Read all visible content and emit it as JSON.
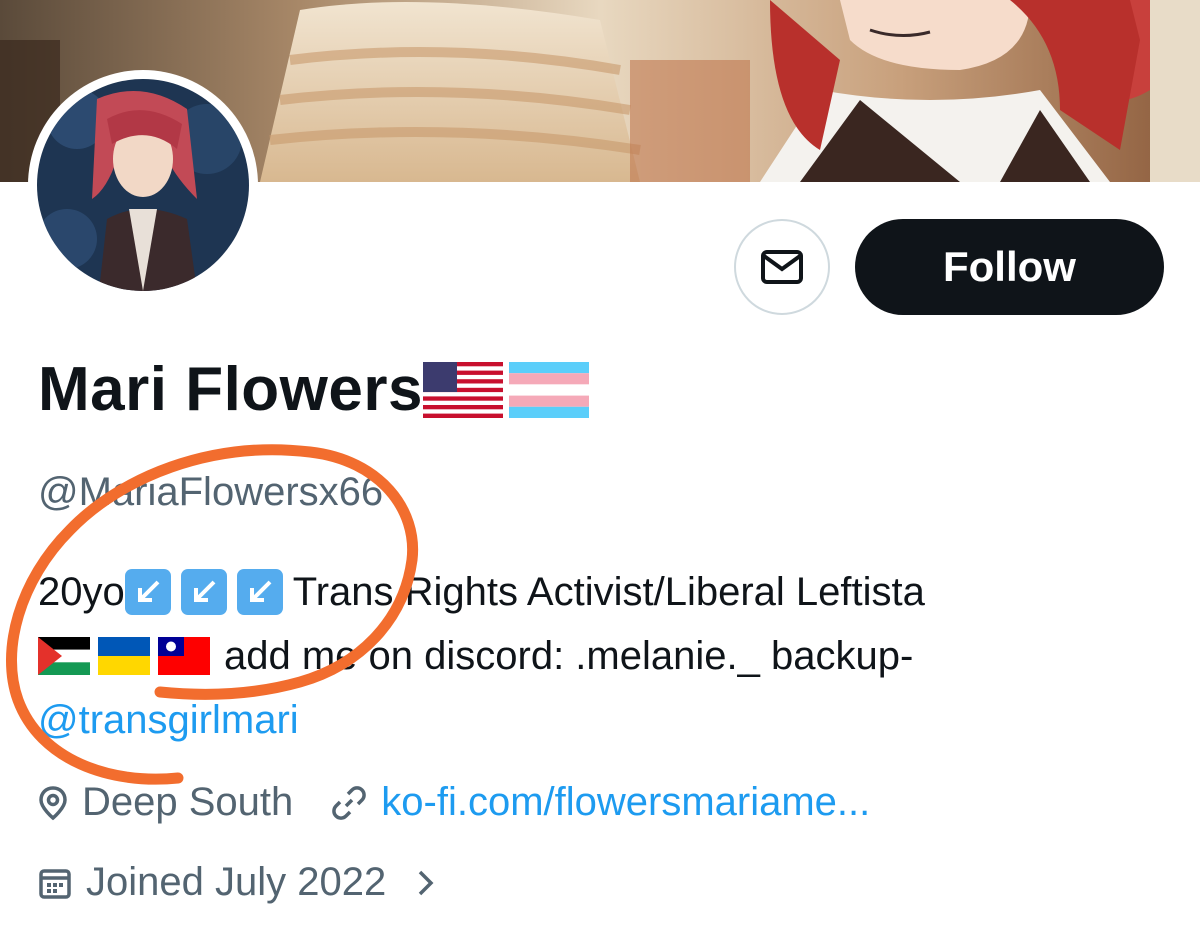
{
  "profile": {
    "display_name": "Mari Flowers",
    "handle": "@MariaFlowersx66",
    "bio_line1_prefix": "20yo",
    "bio_line1_text": "Trans Rights Activist/Liberal Leftista",
    "bio_line2_text": "add me on discord: .melanie._ backup-",
    "bio_mention": "@transgirlmari",
    "location": "Deep South",
    "website": "ko-fi.com/flowersmariame...",
    "joined": "Joined July 2022"
  },
  "actions": {
    "follow_label": "Follow"
  },
  "icons": {
    "message": "envelope-icon",
    "location": "location-pin-icon",
    "website": "link-icon",
    "joined": "calendar-icon",
    "chevron": "chevron-right-icon",
    "bio_emoji": [
      "arrow-down-left-keycap-icon",
      "arrow-down-left-keycap-icon",
      "arrow-down-left-keycap-icon"
    ],
    "name_flags": [
      "us-flag-icon",
      "trans-flag-icon"
    ],
    "bio_flags": [
      "palestine-flag-icon",
      "ukraine-flag-icon",
      "taiwan-flag-icon"
    ]
  },
  "colors": {
    "accent": "#1d9bf0",
    "follow_bg": "#0f1419",
    "secondary_text": "#536471",
    "annotation": "#f26d2e"
  }
}
